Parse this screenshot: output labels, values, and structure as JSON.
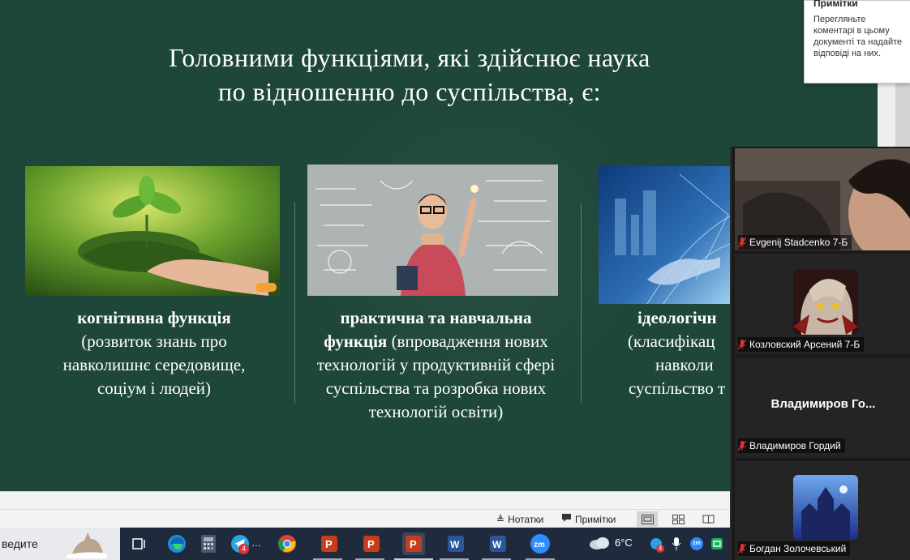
{
  "slide": {
    "title_line1": "Головними функціями, які здійснює наука",
    "title_line2": "по відношенню до суспільства, є:",
    "cards": [
      {
        "bold": "когнітивна функція",
        "text": "(розвиток знань про навколишнє середовище, соціум і людей)"
      },
      {
        "bold_a": "практична та навчальна",
        "bold_b": "функція",
        "text_a": "(впровадження",
        "text_b": "нових технологій у продуктивній сфері суспільства та розробка нових технологій освіти)"
      },
      {
        "bold": "ідеологічн",
        "line2": "(класифікац",
        "line3": "навколи",
        "line4": "суспільство т"
      }
    ],
    "bg_color": "#1e4639"
  },
  "comments_tooltip": {
    "title": "Примітки",
    "text": "Перегляньте коментарі в цьому документі та надайте відповіді на них."
  },
  "statusbar": {
    "notes_label": "Нотатки",
    "comments_label": "Примітки"
  },
  "taskbar": {
    "search_text": "ведите",
    "telegram_badge": "4",
    "weather": "6°C",
    "tray_badge": "4",
    "tray_zoom": "zm"
  },
  "zoom_panel": {
    "participants": [
      {
        "name": "Evgenij Stadcenko 7-Б"
      },
      {
        "name": "Козловский Арсений 7-Б"
      },
      {
        "display": "Владимиров  Го...",
        "name": "Владимиров Гордий"
      },
      {
        "name": "Богдан Золочевський"
      }
    ],
    "muted_color": "#e5322d"
  }
}
